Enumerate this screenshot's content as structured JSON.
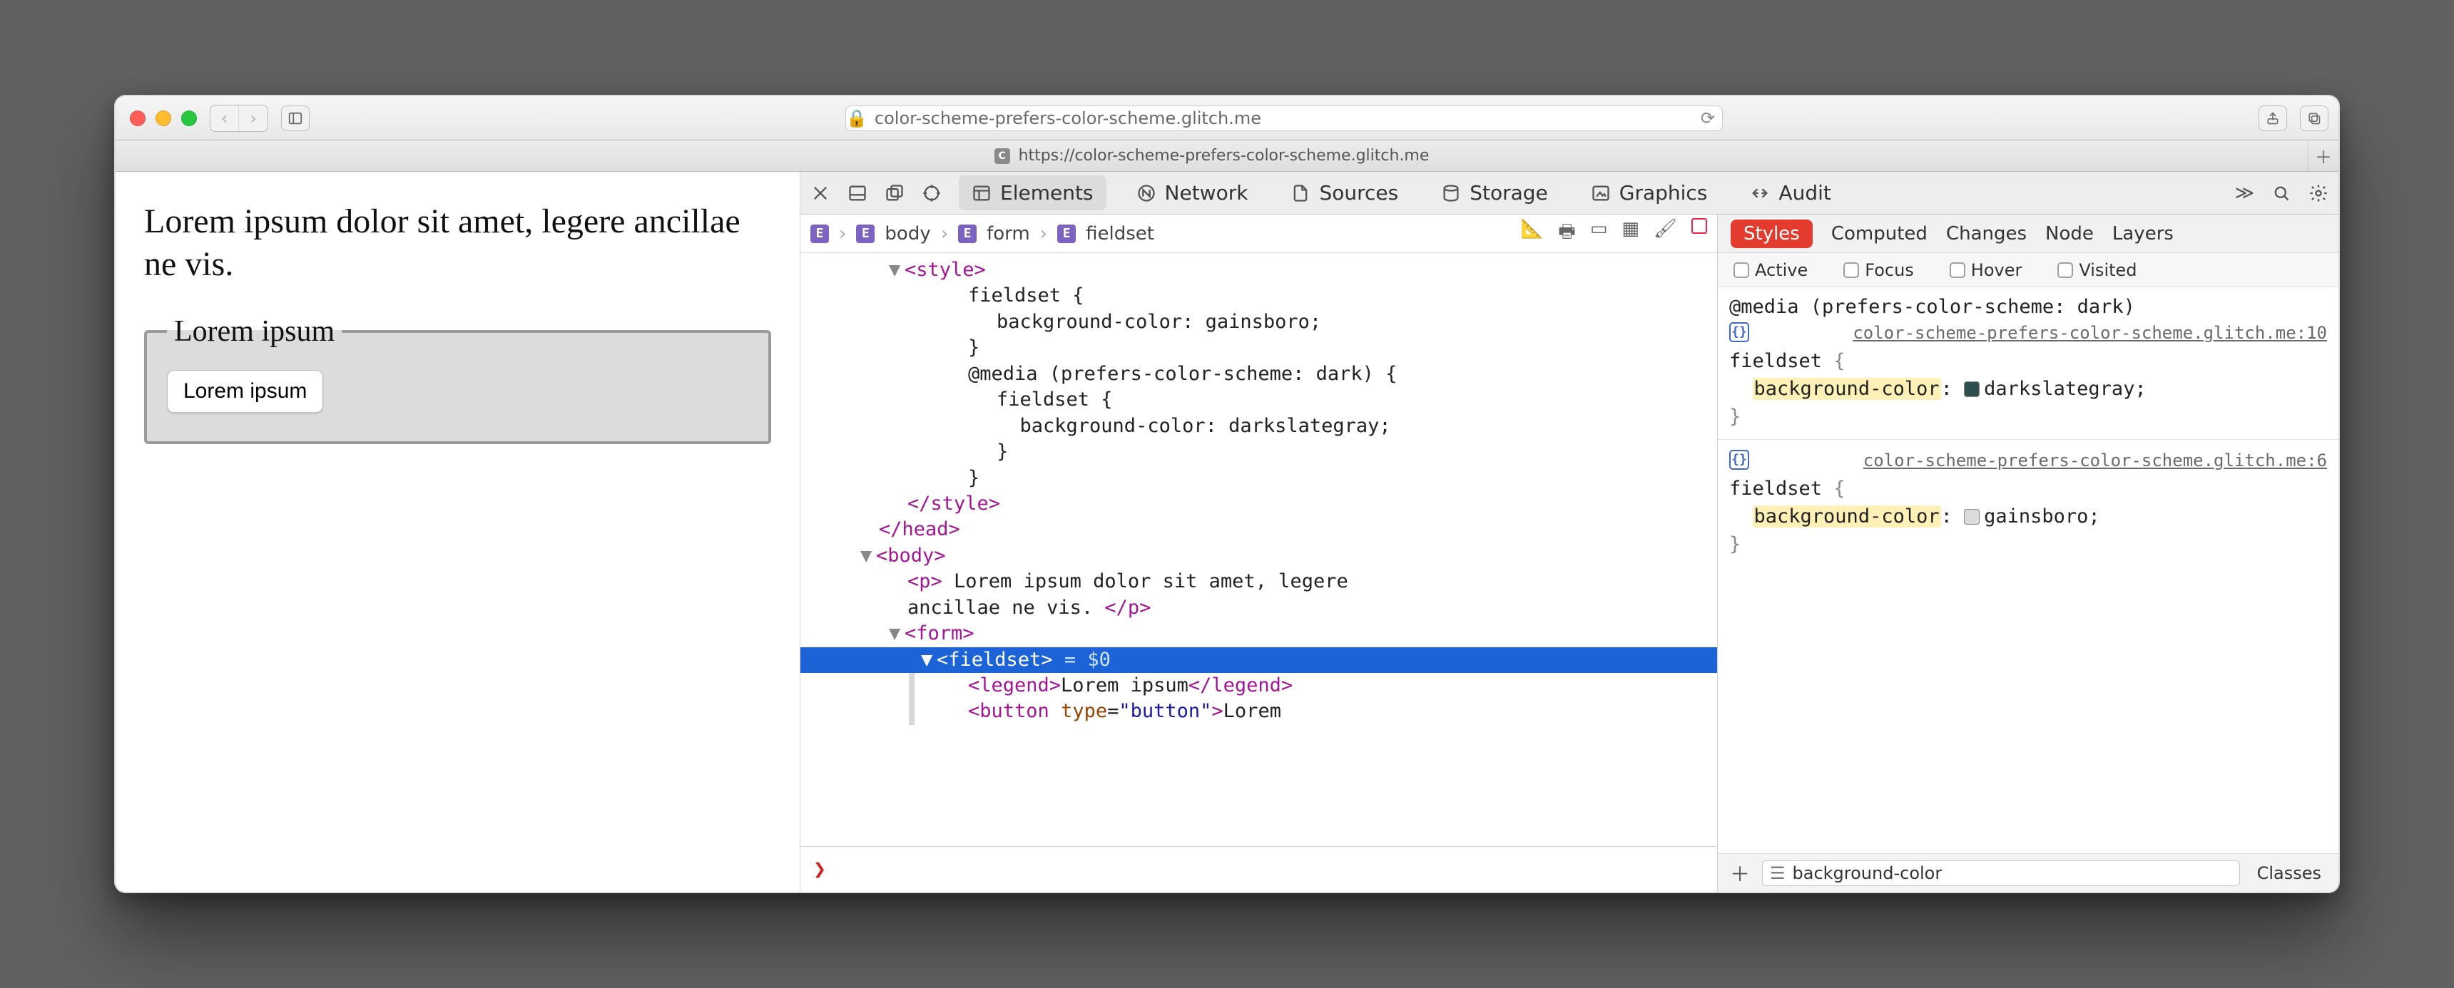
{
  "window": {
    "address_host": "color-scheme-prefers-color-scheme.glitch.me",
    "tab_url": "https://color-scheme-prefers-color-scheme.glitch.me",
    "tab_favicon_letter": "C"
  },
  "page": {
    "paragraph": "Lorem ipsum dolor sit amet, legere ancillae ne vis.",
    "legend": "Lorem ipsum",
    "button": "Lorem ipsum"
  },
  "devtools": {
    "tabs": [
      "Elements",
      "Network",
      "Sources",
      "Storage",
      "Graphics",
      "Audit"
    ],
    "active_tab": "Elements",
    "breadcrumb": [
      "…",
      "body",
      "form",
      "fieldset"
    ],
    "styles_tabs": [
      "Styles",
      "Computed",
      "Changes",
      "Node",
      "Layers"
    ],
    "styles_active": "Styles",
    "pseudo": [
      "Active",
      "Focus",
      "Hover",
      "Visited"
    ],
    "filter_value": "background-color",
    "classes_label": "Classes",
    "selected_eq": "= $0"
  },
  "dom": {
    "lines": [
      {
        "indent": "i2",
        "tw": "▼",
        "html": "<span class='t'>&lt;style&gt;</span>"
      },
      {
        "indent": "i4",
        "html": "fieldset {"
      },
      {
        "indent": "i5",
        "html": "background-color: gainsboro;"
      },
      {
        "indent": "i4",
        "html": "}"
      },
      {
        "indent": "i4",
        "html": "@media (prefers-color-scheme: dark) {"
      },
      {
        "indent": "i5",
        "html": "fieldset {"
      },
      {
        "indent": "i5",
        "html": "  background-color: darkslategray;"
      },
      {
        "indent": "i5",
        "html": "}"
      },
      {
        "indent": "i4",
        "html": "}"
      },
      {
        "indent": "i2",
        "html": "<span class='t'>&lt;/style&gt;</span>"
      },
      {
        "indent": "i1",
        "html": "<span class='t'>&lt;/head&gt;</span>"
      },
      {
        "indent": "i1",
        "tw": "▼",
        "html": "<span class='t'>&lt;body&gt;</span>"
      },
      {
        "indent": "i2",
        "html": "<span class='t'>&lt;p&gt;</span> Lorem ipsum dolor sit amet, legere"
      },
      {
        "indent": "i2",
        "html": "ancillae ne vis. <span class='t'>&lt;/p&gt;</span>"
      },
      {
        "indent": "i2",
        "tw": "▼",
        "html": "<span class='t'>&lt;form&gt;</span>"
      },
      {
        "indent": "i3",
        "tw": "▼",
        "sel": true,
        "html": "<span class='t'>&lt;fieldset&gt;</span> <span class='eq'>= $0</span>"
      },
      {
        "indent": "i4",
        "gut": true,
        "html": "<span class='t'>&lt;legend&gt;</span>Lorem ipsum<span class='t'>&lt;/legend&gt;</span>"
      },
      {
        "indent": "i4",
        "gut": true,
        "html": "<span class='t'>&lt;button</span> <span class='an'>type</span>=<span class='av'>\"button\"</span><span class='t'>&gt;</span>Lorem"
      }
    ]
  },
  "rules": {
    "media_line": "@media (prefers-color-scheme: dark)",
    "src1": "color-scheme-prefers-color-scheme.glitch.me:10",
    "src2": "color-scheme-prefers-color-scheme.glitch.me:6",
    "selector": "fieldset",
    "prop": "background-color",
    "val1": "darkslategray",
    "val2": "gainsboro"
  }
}
